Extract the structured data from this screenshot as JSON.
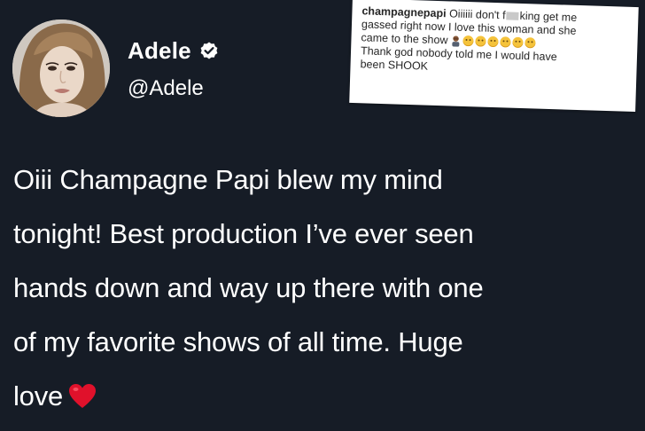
{
  "profile": {
    "display_name": "Adele",
    "handle": "@Adele",
    "verified_icon": "verified-badge-icon",
    "avatar": "profile-photo-avatar"
  },
  "instagram_comment": {
    "username": "champagnepapi",
    "line1_a": " Oiiiiii don't f",
    "line1_b": "king get me",
    "line2": "gassed right now I love this woman and she",
    "line3": "came to the show",
    "line4": "Thank god nobody told me I would have",
    "line5": "been SHOOK",
    "emoji_icons": [
      "person-facepalm-icon",
      "smile-emoji-icon",
      "smile-emoji-icon",
      "smile-emoji-icon",
      "smile-emoji-icon",
      "smile-emoji-icon",
      "smile-emoji-icon"
    ]
  },
  "tweet": {
    "lines": [
      "Oiii Champagne Papi blew my mind",
      "tonight! Best production I’ve ever seen",
      "hands down and way up there with one",
      "of my favorite shows of all time. Huge",
      "love"
    ],
    "trailing_icon": "red-heart-icon"
  },
  "colors": {
    "background": "#161c26",
    "text": "#ffffff",
    "heart": "#e0112b",
    "card": "#ffffff"
  }
}
